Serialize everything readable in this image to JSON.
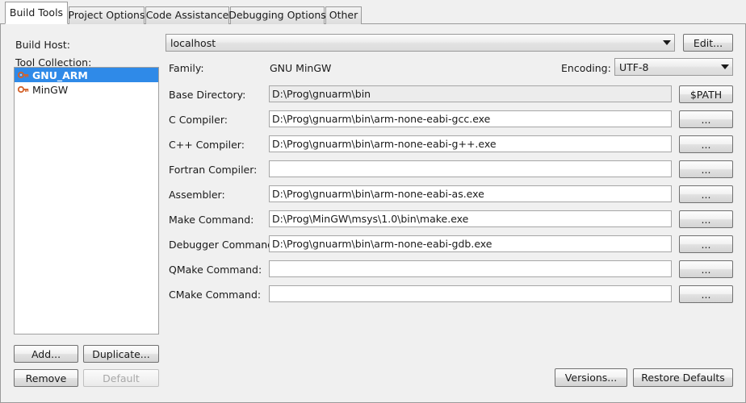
{
  "tabs": [
    {
      "label": "Build Tools",
      "active": true
    },
    {
      "label": "Project Options",
      "active": false
    },
    {
      "label": "Code Assistance",
      "active": false
    },
    {
      "label": "Debugging Options",
      "active": false
    },
    {
      "label": "Other",
      "active": false
    }
  ],
  "left_panel": {
    "build_host_label": "Build Host:",
    "tool_collection_label": "Tool Collection:",
    "tool_collections": [
      {
        "name": "GNU_ARM",
        "icon": "key-icon",
        "selected": true
      },
      {
        "name": "MinGW",
        "icon": "key-icon",
        "selected": false
      }
    ],
    "buttons": {
      "add": "Add...",
      "duplicate": "Duplicate...",
      "remove": "Remove",
      "default": "Default"
    },
    "default_enabled": false
  },
  "build_host": {
    "value": "localhost",
    "edit_button": "Edit..."
  },
  "family": {
    "label": "Family:",
    "value": "GNU MinGW"
  },
  "encoding": {
    "label": "Encoding:",
    "value": "UTF-8"
  },
  "fields": [
    {
      "label": "Base Directory:",
      "value": "D:\\Prog\\gnuarm\\bin",
      "button": "$PATH",
      "readonly": true
    },
    {
      "label": "C Compiler:",
      "value": "D:\\Prog\\gnuarm\\bin\\arm-none-eabi-gcc.exe",
      "button": "...",
      "readonly": false
    },
    {
      "label": "C++ Compiler:",
      "value": "D:\\Prog\\gnuarm\\bin\\arm-none-eabi-g++.exe",
      "button": "...",
      "readonly": false
    },
    {
      "label": "Fortran Compiler:",
      "value": "",
      "button": "...",
      "readonly": false
    },
    {
      "label": "Assembler:",
      "value": "D:\\Prog\\gnuarm\\bin\\arm-none-eabi-as.exe",
      "button": "...",
      "readonly": false
    },
    {
      "label": "Make Command:",
      "value": "D:\\Prog\\MinGW\\msys\\1.0\\bin\\make.exe",
      "button": "...",
      "readonly": false
    },
    {
      "label": "Debugger Command:",
      "value": "D:\\Prog\\gnuarm\\bin\\arm-none-eabi-gdb.exe",
      "button": "...",
      "readonly": false
    },
    {
      "label": "QMake Command:",
      "value": "",
      "button": "...",
      "readonly": false
    },
    {
      "label": "CMake Command:",
      "value": "",
      "button": "...",
      "readonly": false
    }
  ],
  "footer": {
    "versions": "Versions...",
    "restore_defaults": "Restore Defaults"
  },
  "colors": {
    "selection": "#2f8ae8",
    "key_icon": "#d4622a",
    "panel_bg": "#f0f0f0",
    "field_bg": "#ffffff",
    "field_readonly_bg": "#ececec"
  }
}
